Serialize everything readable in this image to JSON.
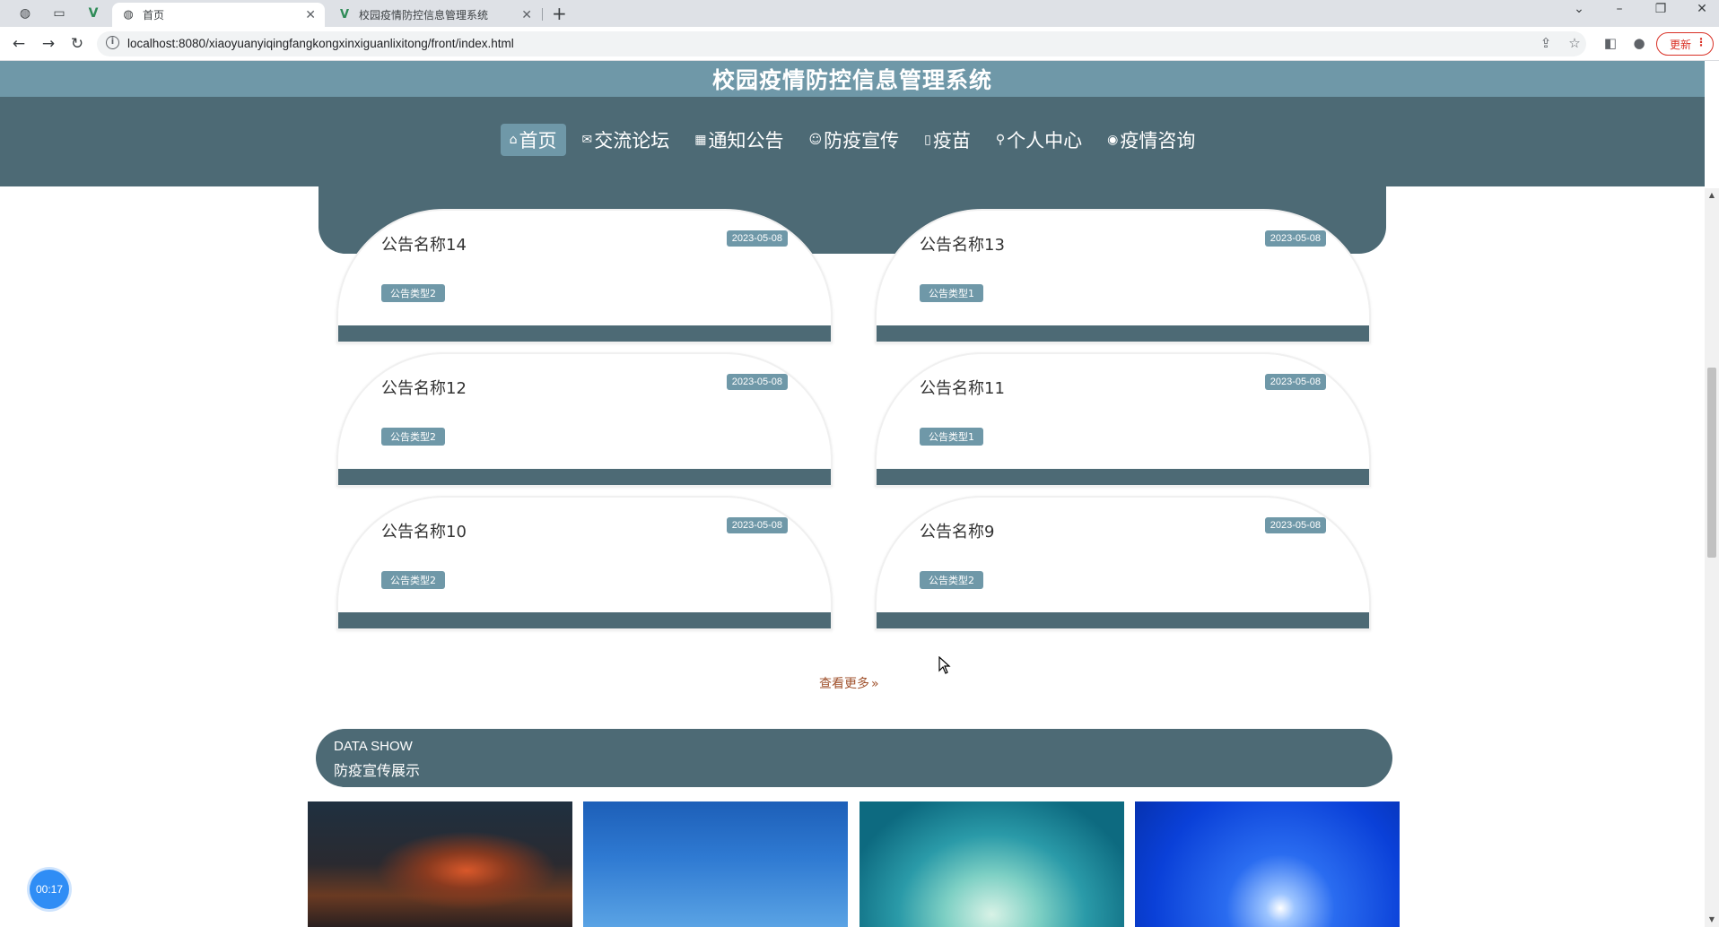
{
  "browser": {
    "tabs": [
      {
        "title": "首页",
        "icon": "globe-icon",
        "active": true
      },
      {
        "title": "校园疫情防控信息管理系统",
        "icon": "vue-logo-icon",
        "active": false
      }
    ],
    "url": "localhost:8080/xiaoyuanyiqingfangkongxinxiguanlixitong/front/index.html",
    "update_label": "更新"
  },
  "site": {
    "title": "校园疫情防控信息管理系统",
    "nav": [
      {
        "label": "首页",
        "icon": "home-icon",
        "active": true
      },
      {
        "label": "交流论坛",
        "icon": "mail-icon",
        "active": false
      },
      {
        "label": "通知公告",
        "icon": "grid-icon",
        "active": false
      },
      {
        "label": "防疫宣传",
        "icon": "smile-icon",
        "active": false
      },
      {
        "label": "疫苗",
        "icon": "square-icon",
        "active": false
      },
      {
        "label": "个人中心",
        "icon": "user-icon",
        "active": false
      },
      {
        "label": "疫情咨询",
        "icon": "chat-icon",
        "active": false
      }
    ]
  },
  "notices": [
    {
      "title": "公告名称14",
      "date": "2023-05-08",
      "type": "公告类型2"
    },
    {
      "title": "公告名称13",
      "date": "2023-05-08",
      "type": "公告类型1"
    },
    {
      "title": "公告名称12",
      "date": "2023-05-08",
      "type": "公告类型2"
    },
    {
      "title": "公告名称11",
      "date": "2023-05-08",
      "type": "公告类型1"
    },
    {
      "title": "公告名称10",
      "date": "2023-05-08",
      "type": "公告类型2"
    },
    {
      "title": "公告名称9",
      "date": "2023-05-08",
      "type": "公告类型2"
    }
  ],
  "more_label": "查看更多",
  "section": {
    "en": "DATA SHOW",
    "cn": "防疫宣传展示"
  },
  "timer": "00:17",
  "colors": {
    "primary": "#4d6a75",
    "accent": "#6f98a8",
    "more_link": "#a0522d"
  }
}
